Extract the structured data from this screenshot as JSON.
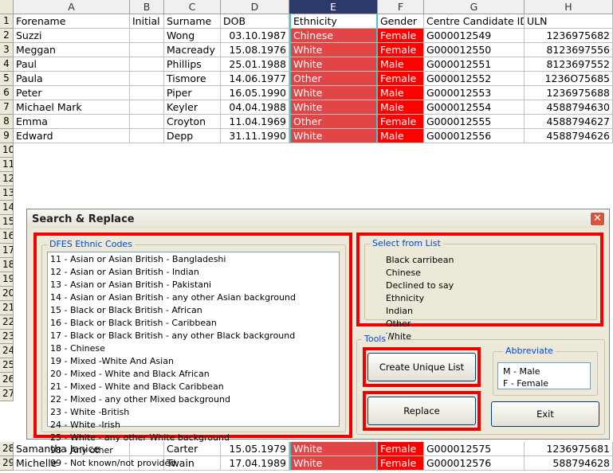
{
  "sheet": {
    "columns": [
      "A",
      "B",
      "C",
      "D",
      "E",
      "F",
      "G",
      "H"
    ],
    "selected_column": "E",
    "headers_row": {
      "num": "1",
      "a": "Forename",
      "b": "Initial",
      "c": "Surname",
      "d": "DOB",
      "e": "Ethnicity",
      "f": "Gender",
      "g": "Centre Candidate ID.",
      "h": "ULN"
    },
    "rows": [
      {
        "num": "2",
        "a": "Suzzi",
        "b": "",
        "c": "Wong",
        "d": "03.10.1987",
        "e": "Chinese",
        "f": "Female",
        "g": "G000012549",
        "h": "1236975682"
      },
      {
        "num": "3",
        "a": "Meggan",
        "b": "",
        "c": "Macready",
        "d": "15.08.1976",
        "e": "White",
        "f": "Female",
        "g": "G000012550",
        "h": "8123697556"
      },
      {
        "num": "4",
        "a": "Paul",
        "b": "",
        "c": "Phillips",
        "d": "25.01.1988",
        "e": "White",
        "f": "Male",
        "g": "G000012551",
        "h": "8123697552"
      },
      {
        "num": "5",
        "a": "Paula",
        "b": "",
        "c": "Tismore",
        "d": "14.06.1977",
        "e": "Other",
        "f": "Female",
        "g": "G000012552",
        "h": "1236O75685"
      },
      {
        "num": "6",
        "a": "Peter",
        "b": "",
        "c": "Piper",
        "d": "16.05.1990",
        "e": "White",
        "f": "Male",
        "g": "G000012553",
        "h": "1236975688"
      },
      {
        "num": "7",
        "a": "Michael Mark",
        "b": "",
        "c": "Keyler",
        "d": "04.04.1988",
        "e": "White",
        "f": "Male",
        "g": "G000012554",
        "h": "4588794630"
      },
      {
        "num": "8",
        "a": "Emma",
        "b": "",
        "c": "Croyton",
        "d": "11.04.1969",
        "e": "Other",
        "f": "Female",
        "g": "G000012555",
        "h": "4588794627"
      },
      {
        "num": "9",
        "a": "Edward",
        "b": "",
        "c": "Depp",
        "d": "31.11.1990",
        "e": "White",
        "f": "Male",
        "g": "G000012556",
        "h": "4588794626"
      }
    ],
    "hidden_row_numbers": [
      "10",
      "11",
      "12",
      "13",
      "14",
      "15",
      "16",
      "17",
      "18",
      "19",
      "20",
      "21",
      "22",
      "23",
      "24",
      "25",
      "26",
      "27"
    ],
    "bottom_rows": [
      {
        "num": "28",
        "a": "Samantha Janice",
        "b": "",
        "c": "Carter",
        "d": "15.05.1979",
        "e": "White",
        "f": "Female",
        "g": "G000012575",
        "h": "1236975681"
      },
      {
        "num": "29",
        "a": "Michelle",
        "b": "",
        "c": "Twain",
        "d": "17.04.1989",
        "e": "White",
        "f": "Female",
        "g": "G000012576",
        "h": "588794628"
      }
    ]
  },
  "dialog": {
    "title": "Search & Replace",
    "close_glyph": "✕",
    "dfes": {
      "label": "DFES Ethnic Codes",
      "items": [
        "11 - Asian or Asian British - Bangladeshi",
        "12 - Asian or Asian British - Indian",
        "13 - Asian or Asian British - Pakistani",
        "14 - Asian or Asian British - any other Asian background",
        "15 - Black or Black British - African",
        "16 - Black or Black British - Caribbean",
        "17 - Black or Black British - any other Black background",
        "18 - Chinese",
        "19 - Mixed -White And Asian",
        "20 - Mixed - White and Black African",
        "21 - Mixed - White and Black Caribbean",
        "22 - Mixed - any other Mixed background",
        "23 - White -British",
        "24 - White -Irish",
        "25 - White - any other White background",
        "98 - Any other",
        "99 - Not known/not provided"
      ]
    },
    "select_list": {
      "label": "Select from List",
      "items": [
        "Black carribean",
        "Chinese",
        "Declined to say",
        "Ethnicity",
        "Indian",
        "Other",
        "White"
      ]
    },
    "tools": {
      "label": "Tools",
      "create_unique_label": "Create Unique List",
      "replace_label": "Replace",
      "exit_label": "Exit",
      "abbreviate": {
        "label": "Abbreviate",
        "lines": [
          "M - Male",
          "F - Female"
        ]
      }
    }
  },
  "colors": {
    "highlight_red": "#ee0000",
    "ethnicity_fill": "#e24545",
    "gender_fill": "#ff0000",
    "selection_outline": "#3ec7cc"
  }
}
